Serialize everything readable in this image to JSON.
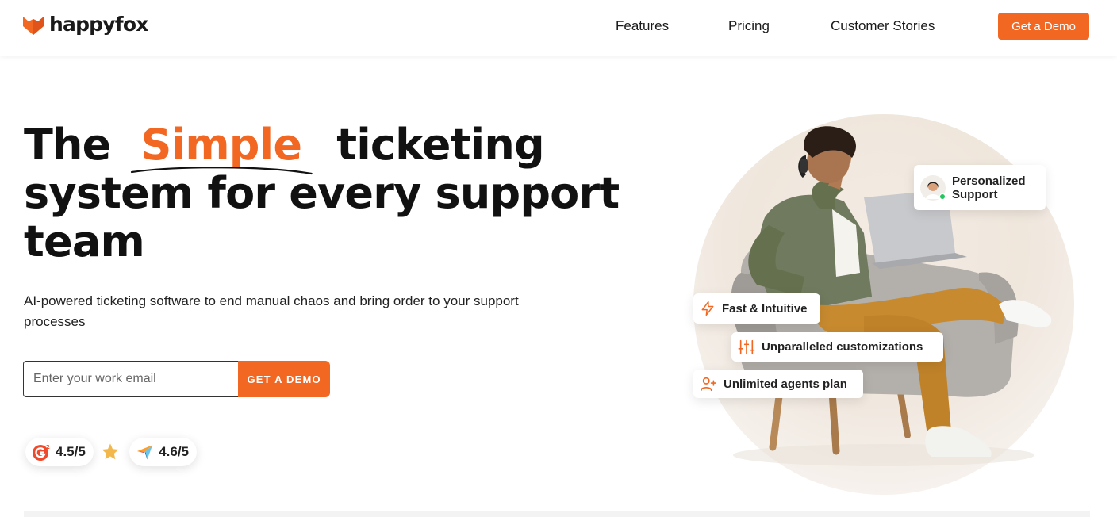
{
  "header": {
    "brand": "happyfox",
    "nav": {
      "features": "Features",
      "pricing": "Pricing",
      "customer_stories": "Customer Stories"
    },
    "cta": "Get a Demo"
  },
  "hero": {
    "title_before": "The",
    "title_highlight": "Simple",
    "title_after": "ticketing",
    "title_line2": "system for every support",
    "title_line3": "team",
    "subtitle": "AI-powered ticketing software to end manual chaos and bring order to your support processes",
    "email_placeholder": "Enter your work email",
    "form_button": "GET A DEMO"
  },
  "ratings": [
    {
      "source_icon": "g2-logo-icon",
      "value": "4.5/5"
    },
    {
      "source_icon": "capterra-logo-icon",
      "value": "4.6/5"
    }
  ],
  "badges": {
    "personalized": "Personalized Support",
    "fast": "Fast & Intuitive",
    "customizations": "Unparalleled customizations",
    "agents": "Unlimited agents plan"
  },
  "colors": {
    "accent": "#f26722",
    "text": "#111111",
    "star": "#f2b84b"
  }
}
